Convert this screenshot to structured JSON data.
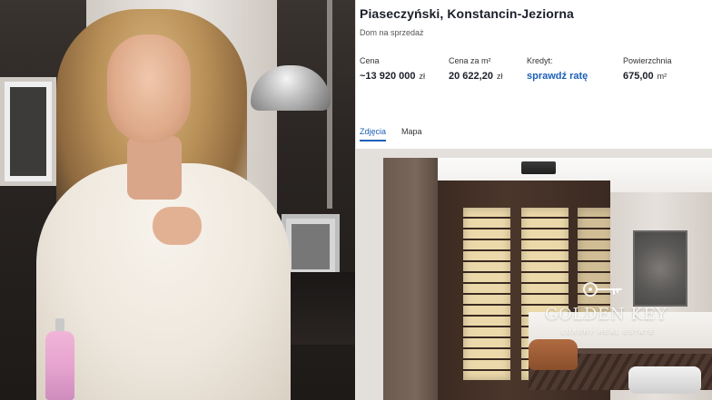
{
  "listing": {
    "title": "Piaseczyński, Konstancin-Jeziorna",
    "subtitle": "Dom na sprzedaż",
    "stats": {
      "price": {
        "label": "Cena",
        "value": "~13 920 000",
        "unit": "zł"
      },
      "price_per_sqm": {
        "label": "Cena za m²",
        "value": "20 622,20",
        "unit": "zł"
      },
      "credit": {
        "label": "Kredyt:",
        "link": "sprawdź ratę"
      },
      "area": {
        "label": "Powierzchnia",
        "value": "675,00",
        "unit": "m²"
      }
    },
    "tabs": [
      {
        "label": "Zdjęcia",
        "active": true
      },
      {
        "label": "Mapa",
        "active": false
      }
    ],
    "photo_watermark": {
      "brand": "GOLDEN KEY",
      "tagline": "LUXURY REAL ESTATE"
    }
  },
  "colors": {
    "accent_blue": "#1c5fb8",
    "text_dark": "#1b1f29"
  }
}
